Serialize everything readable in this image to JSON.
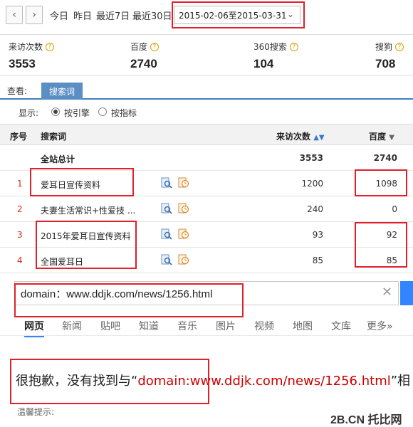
{
  "toolbar": {
    "prev_icon": "chevron-left-icon",
    "next_icon": "chevron-right-icon",
    "quick_ranges": [
      "今日",
      "昨日",
      "最近7日",
      "最近30日"
    ],
    "date_range": "2015-02-06至2015-03-31"
  },
  "stats": [
    {
      "label": "来访次数",
      "value": "3553"
    },
    {
      "label": "百度",
      "value": "2740"
    },
    {
      "label": "360搜索",
      "value": "104"
    },
    {
      "label": "搜狗",
      "value": "708"
    }
  ],
  "view": {
    "label": "查看:",
    "active_tab": "搜索词"
  },
  "display": {
    "label": "显示:",
    "options": [
      "按引擎",
      "按指标"
    ],
    "selected": "按引擎"
  },
  "table": {
    "headers": {
      "idx": "序号",
      "keyword": "搜索词",
      "visits": "来访次数",
      "baidu": "百度"
    },
    "total": {
      "keyword": "全站总计",
      "visits": "3553",
      "baidu": "2740"
    },
    "rows": [
      {
        "idx": "1",
        "keyword": "爱耳日宣传资料",
        "visits": "1200",
        "baidu": "1098"
      },
      {
        "idx": "2",
        "keyword": "夫妻生活常识+性爱技 ...",
        "visits": "240",
        "baidu": "0"
      },
      {
        "idx": "3",
        "keyword": "2015年爱耳日宣传资料",
        "visits": "93",
        "baidu": "92"
      },
      {
        "idx": "4",
        "keyword": "全国爱耳日",
        "visits": "85",
        "baidu": "85"
      }
    ]
  },
  "search": {
    "query": "domain：www.ddjk.com/news/1256.html",
    "clear_icon": "close-icon"
  },
  "tabs": [
    "网页",
    "新闻",
    "贴吧",
    "知道",
    "音乐",
    "图片",
    "视频",
    "地图",
    "文库",
    "更多»"
  ],
  "result": {
    "prefix": "很抱歉，没有找到与“",
    "highlight": "domain:www.ddjk.com/news/1256.html",
    "suffix": "”相"
  },
  "hint": "温馨提示:",
  "watermark": "2B.CN 托比网",
  "colors": {
    "accent": "#3385ff",
    "tab_active": "#5b8fc4",
    "highlight_box": "#e0202a"
  }
}
